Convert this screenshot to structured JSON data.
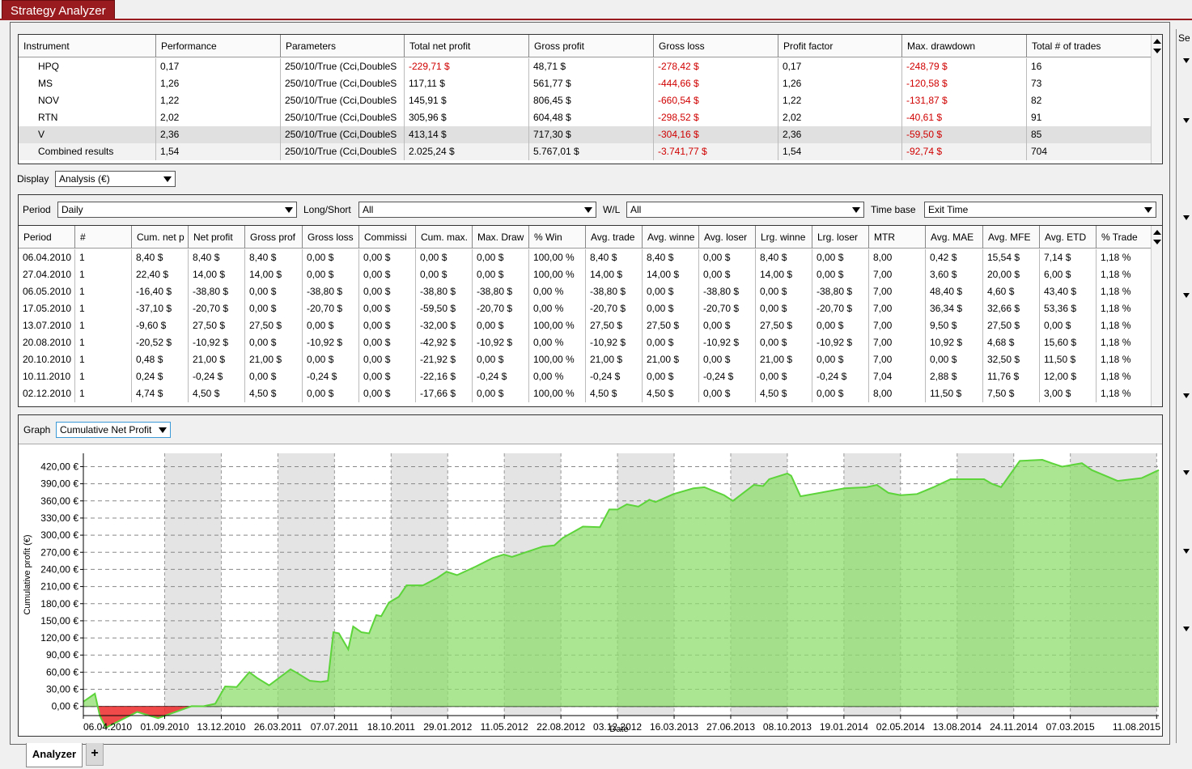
{
  "window": {
    "title": "Strategy Analyzer"
  },
  "instruments": {
    "columns": [
      {
        "label": "Instrument",
        "w": 170
      },
      {
        "label": "Performance",
        "w": 154
      },
      {
        "label": "Parameters",
        "w": 153
      },
      {
        "label": "Total net profit",
        "w": 154
      },
      {
        "label": "Gross profit",
        "w": 154
      },
      {
        "label": "Gross loss",
        "w": 154
      },
      {
        "label": "Profit factor",
        "w": 153
      },
      {
        "label": "Max. drawdown",
        "w": 154
      },
      {
        "label": "Total # of trades",
        "w": 154
      }
    ],
    "rows": [
      {
        "cells": [
          "HPQ",
          "0,17",
          "250/10/True (Cci,DoubleS",
          "-229,71 $",
          "48,71 $",
          "-278,42 $",
          "0,17",
          "-248,79 $",
          "16"
        ],
        "state": ""
      },
      {
        "cells": [
          "MS",
          "1,26",
          "250/10/True (Cci,DoubleS",
          "117,11 $",
          "561,77 $",
          "-444,66 $",
          "1,26",
          "-120,58 $",
          "73"
        ],
        "state": ""
      },
      {
        "cells": [
          "NOV",
          "1,22",
          "250/10/True (Cci,DoubleS",
          "145,91 $",
          "806,45 $",
          "-660,54 $",
          "1,22",
          "-131,87 $",
          "82"
        ],
        "state": ""
      },
      {
        "cells": [
          "RTN",
          "2,02",
          "250/10/True (Cci,DoubleS",
          "305,96 $",
          "604,48 $",
          "-298,52 $",
          "2,02",
          "-40,61 $",
          "91"
        ],
        "state": ""
      },
      {
        "cells": [
          "V",
          "2,36",
          "250/10/True (Cci,DoubleS",
          "413,14 $",
          "717,30 $",
          "-304,16 $",
          "2,36",
          "-59,50 $",
          "85"
        ],
        "state": "sel"
      },
      {
        "cells": [
          "Combined results",
          "1,54",
          "250/10/True (Cci,DoubleS",
          "2.025,24 $",
          "5.767,01 $",
          "-3.741,77 $",
          "1,54",
          "-92,74 $",
          "704"
        ],
        "state": "comb"
      }
    ]
  },
  "display": {
    "label": "Display",
    "value": "Analysis (€)"
  },
  "filters": {
    "period_label": "Period",
    "period_value": "Daily",
    "longshort_label": "Long/Short",
    "longshort_value": "All",
    "wl_label": "W/L",
    "wl_value": "All",
    "timebase_label": "Time base",
    "timebase_value": "Exit Time"
  },
  "periods": {
    "columns": [
      {
        "label": "Period",
        "w": 70
      },
      {
        "label": "#",
        "w": 70
      },
      {
        "label": "Cum. net p",
        "w": 70
      },
      {
        "label": "Net profit",
        "w": 70
      },
      {
        "label": "Gross prof",
        "w": 71
      },
      {
        "label": "Gross loss",
        "w": 70
      },
      {
        "label": "Commissi",
        "w": 70
      },
      {
        "label": "Cum. max.",
        "w": 70
      },
      {
        "label": "Max. Draw",
        "w": 70
      },
      {
        "label": "% Win",
        "w": 70
      },
      {
        "label": "Avg. trade",
        "w": 70
      },
      {
        "label": "Avg. winne",
        "w": 70
      },
      {
        "label": "Avg. loser",
        "w": 70
      },
      {
        "label": "Lrg. winne",
        "w": 70
      },
      {
        "label": "Lrg. loser",
        "w": 70
      },
      {
        "label": "MTR",
        "w": 70
      },
      {
        "label": "Avg. MAE",
        "w": 71
      },
      {
        "label": "Avg. MFE",
        "w": 70
      },
      {
        "label": "Avg. ETD",
        "w": 70
      },
      {
        "label": "% Trade",
        "w": 70
      }
    ],
    "rows": [
      [
        "06.04.2010",
        "1",
        "8,40 $",
        "8,40 $",
        "8,40 $",
        "0,00 $",
        "0,00 $",
        "0,00 $",
        "0,00 $",
        "100,00 %",
        "8,40 $",
        "8,40 $",
        "0,00 $",
        "8,40 $",
        "0,00 $",
        "8,00",
        "0,42 $",
        "15,54 $",
        "7,14 $",
        "1,18 %"
      ],
      [
        "27.04.2010",
        "1",
        "22,40 $",
        "14,00 $",
        "14,00 $",
        "0,00 $",
        "0,00 $",
        "0,00 $",
        "0,00 $",
        "100,00 %",
        "14,00 $",
        "14,00 $",
        "0,00 $",
        "14,00 $",
        "0,00 $",
        "7,00",
        "3,60 $",
        "20,00 $",
        "6,00 $",
        "1,18 %"
      ],
      [
        "06.05.2010",
        "1",
        "-16,40 $",
        "-38,80 $",
        "0,00 $",
        "-38,80 $",
        "0,00 $",
        "-38,80 $",
        "-38,80 $",
        "0,00 %",
        "-38,80 $",
        "0,00 $",
        "-38,80 $",
        "0,00 $",
        "-38,80 $",
        "7,00",
        "48,40 $",
        "4,60 $",
        "43,40 $",
        "1,18 %"
      ],
      [
        "17.05.2010",
        "1",
        "-37,10 $",
        "-20,70 $",
        "0,00 $",
        "-20,70 $",
        "0,00 $",
        "-59,50 $",
        "-20,70 $",
        "0,00 %",
        "-20,70 $",
        "0,00 $",
        "-20,70 $",
        "0,00 $",
        "-20,70 $",
        "7,00",
        "36,34 $",
        "32,66 $",
        "53,36 $",
        "1,18 %"
      ],
      [
        "13.07.2010",
        "1",
        "-9,60 $",
        "27,50 $",
        "27,50 $",
        "0,00 $",
        "0,00 $",
        "-32,00 $",
        "0,00 $",
        "100,00 %",
        "27,50 $",
        "27,50 $",
        "0,00 $",
        "27,50 $",
        "0,00 $",
        "7,00",
        "9,50 $",
        "27,50 $",
        "0,00 $",
        "1,18 %"
      ],
      [
        "20.08.2010",
        "1",
        "-20,52 $",
        "-10,92 $",
        "0,00 $",
        "-10,92 $",
        "0,00 $",
        "-42,92 $",
        "-10,92 $",
        "0,00 %",
        "-10,92 $",
        "0,00 $",
        "-10,92 $",
        "0,00 $",
        "-10,92 $",
        "7,00",
        "10,92 $",
        "4,68 $",
        "15,60 $",
        "1,18 %"
      ],
      [
        "20.10.2010",
        "1",
        "0,48 $",
        "21,00 $",
        "21,00 $",
        "0,00 $",
        "0,00 $",
        "-21,92 $",
        "0,00 $",
        "100,00 %",
        "21,00 $",
        "21,00 $",
        "0,00 $",
        "21,00 $",
        "0,00 $",
        "7,00",
        "0,00 $",
        "32,50 $",
        "11,50 $",
        "1,18 %"
      ],
      [
        "10.11.2010",
        "1",
        "0,24 $",
        "-0,24 $",
        "0,00 $",
        "-0,24 $",
        "0,00 $",
        "-22,16 $",
        "-0,24 $",
        "0,00 %",
        "-0,24 $",
        "0,00 $",
        "-0,24 $",
        "0,00 $",
        "-0,24 $",
        "7,04",
        "2,88 $",
        "11,76 $",
        "12,00 $",
        "1,18 %"
      ],
      [
        "02.12.2010",
        "1",
        "4,74 $",
        "4,50 $",
        "4,50 $",
        "0,00 $",
        "0,00 $",
        "-17,66 $",
        "0,00 $",
        "100,00 %",
        "4,50 $",
        "4,50 $",
        "0,00 $",
        "4,50 $",
        "0,00 $",
        "8,00",
        "11,50 $",
        "7,50 $",
        "3,00 $",
        "1,18 %"
      ]
    ]
  },
  "graph": {
    "label": "Graph",
    "value": "Cumulative Net Profit"
  },
  "chart_data": {
    "type": "area",
    "ylabel": "Cumulative profit (€)",
    "xlabel": "Date",
    "ylim": [
      -16,
      432
    ],
    "yticks": [
      "0,00 €",
      "30,00 €",
      "60,00 €",
      "90,00 €",
      "120,00 €",
      "150,00 €",
      "180,00 €",
      "210,00 €",
      "240,00 €",
      "270,00 €",
      "300,00 €",
      "330,00 €",
      "360,00 €",
      "390,00 €",
      "420,00 €"
    ],
    "ytick_values": [
      0,
      30,
      60,
      90,
      120,
      150,
      180,
      210,
      240,
      270,
      300,
      330,
      360,
      390,
      420
    ],
    "xticks": [
      "06.04.2010",
      "01.09.2010",
      "13.12.2010",
      "26.03.2011",
      "07.07.2011",
      "18.10.2011",
      "29.01.2012",
      "11.05.2012",
      "22.08.2012",
      "03.12.2012",
      "16.03.2013",
      "27.06.2013",
      "08.10.2013",
      "19.01.2014",
      "02.05.2014",
      "13.08.2014",
      "24.11.2014",
      "07.03.2015",
      "11.08.2015"
    ],
    "x": [
      "06.04.2010",
      "27.04.2010",
      "06.05.2010",
      "17.05.2010",
      "13.07.2010",
      "20.08.2010",
      "20.10.2010",
      "10.11.2010",
      "02.12.2010",
      "20.12.2010",
      "10.01.2011",
      "02.02.2011",
      "16.02.2011",
      "10.03.2011",
      "18.04.2011",
      "01.05.2011",
      "23.05.2011",
      "12.06.2011",
      "25.06.2011",
      "05.07.2011",
      "15.07.2011",
      "01.08.2011",
      "10.08.2011",
      "25.08.2011",
      "08.09.2011",
      "21.09.2011",
      "30.09.2011",
      "14.10.2011",
      "01.11.2011",
      "15.11.2011",
      "15.12.2011",
      "10.01.2012",
      "27.01.2012",
      "15.02.2012",
      "20.03.2012",
      "20.04.2012",
      "10.05.2012",
      "25.05.2012",
      "20.07.2012",
      "10.08.2012",
      "25.08.2012",
      "01.10.2012",
      "01.11.2012",
      "18.11.2012",
      "03.12.2012",
      "20.12.2012",
      "10.01.2013",
      "30.01.2013",
      "10.02.2013",
      "15.03.2013",
      "20.04.2013",
      "10.05.2013",
      "15.06.2013",
      "01.07.2013",
      "08.08.2013",
      "25.08.2013",
      "05.09.2013",
      "08.10.2013",
      "15.10.2013",
      "01.11.2013",
      "20.01.2014",
      "01.03.2014",
      "20.03.2014",
      "10.04.2014",
      "02.05.2014",
      "01.06.2014",
      "01.07.2014",
      "01.08.2014",
      "01.10.2014",
      "15.10.2014",
      "01.11.2014",
      "05.12.2014",
      "15.01.2015",
      "01.02.2015",
      "20.02.2015",
      "28.03.2015",
      "15.04.2015",
      "01.06.2015",
      "15.07.2015",
      "15.08.2015"
    ],
    "values": [
      8.4,
      22.4,
      -16.4,
      -37.1,
      -9.6,
      -20.52,
      0.48,
      0.24,
      4.74,
      35,
      34,
      60,
      50,
      37,
      65,
      58,
      45,
      43,
      45,
      130,
      128,
      100,
      140,
      130,
      128,
      160,
      158,
      182,
      192,
      212,
      212,
      225,
      236,
      230,
      245,
      260,
      266,
      262,
      280,
      282,
      295,
      315,
      314,
      345,
      345,
      354,
      350,
      362,
      358,
      372,
      382,
      384,
      370,
      360,
      388,
      386,
      398,
      408,
      404,
      368,
      382,
      384,
      388,
      374,
      370,
      372,
      384,
      398,
      398,
      390,
      384,
      430,
      432,
      426,
      420,
      426,
      414,
      395,
      400,
      414
    ]
  },
  "right_panel": {
    "title": "Se"
  },
  "bottom_tabs": {
    "active": "Analyzer",
    "add": "+"
  }
}
